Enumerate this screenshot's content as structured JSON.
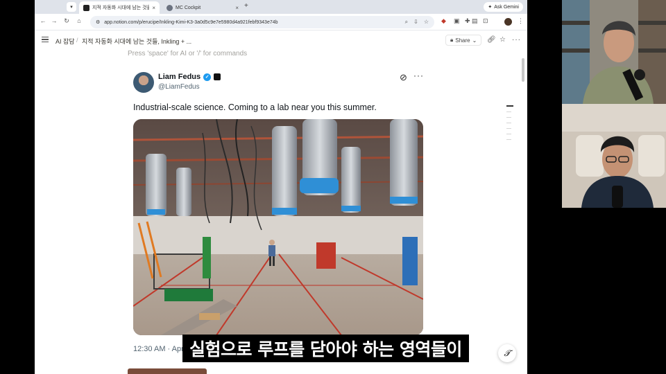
{
  "browser": {
    "tabs": [
      {
        "title": "지적 자동화 시대에 남는 것들, Ink",
        "active": true
      },
      {
        "title": "MC Cockpit",
        "active": false
      }
    ],
    "new_tab_glyph": "+",
    "gemini_label": "Ask Gemini",
    "url": "app.notion.com/p/erucipe/Inkling-Kimi-K3-3a0d5c9e7e5980d4a921febf9343e74b"
  },
  "notion": {
    "breadcrumb": [
      "AI 잡담",
      "지적 자동화 시대에 남는 것들, Inkling + ..."
    ],
    "breadcrumb_sep": "/",
    "share_label": "Share",
    "placeholder": "Press 'space' for AI or '/' for commands"
  },
  "tweet": {
    "author_name": "Liam Fedus",
    "handle": "@LiamFedus",
    "text": "Industrial-scale science. Coming to a lab near you this summer.",
    "timestamp": "12:30 AM · Apr",
    "more_glyph": "···"
  },
  "subtitle": "실험으로 루프를 닫아야 하는 영역들이",
  "colors": {
    "verified": "#1d9bf0",
    "tabbar": "#dfe3ea",
    "omnibox": "#eef1f6"
  }
}
